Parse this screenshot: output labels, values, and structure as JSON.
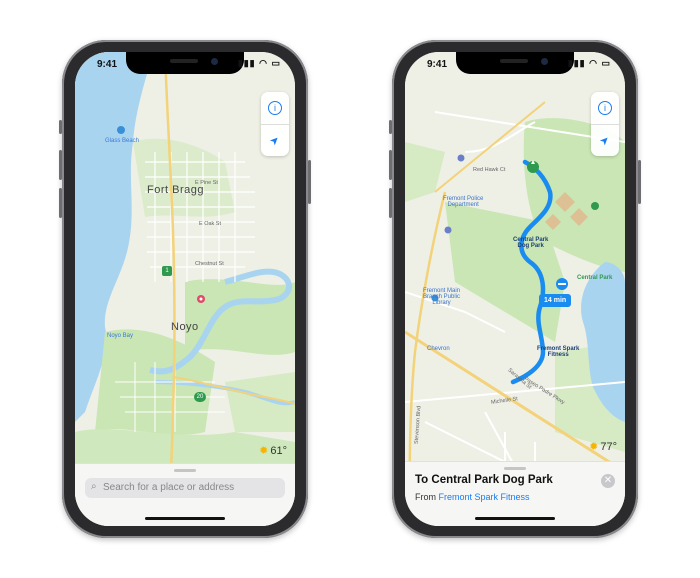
{
  "left_phone": {
    "status": {
      "time": "9:41",
      "icons": "▮▮▮ ◠ ▭"
    },
    "controls": {
      "info_icon": "i",
      "location_icon": "➤"
    },
    "map_labels": {
      "glass_beach": "Glass Beach",
      "fort_bragg": "Fort Bragg",
      "e_pine_st": "E Pine St",
      "e_oak_st": "E Oak St",
      "chestnut_st": "Chestnut St",
      "noyo": "Noyo",
      "noyo_bay": "Noyo Bay",
      "route_1": "1",
      "route_20": "20"
    },
    "weather": {
      "temp": "61°"
    },
    "search": {
      "placeholder": "Search for a place or address"
    }
  },
  "right_phone": {
    "status": {
      "time": "9:41",
      "icons": "▮▮▮ ◠ ▭"
    },
    "controls": {
      "info_icon": "i",
      "location_icon": "➤"
    },
    "map_labels": {
      "red_hawk_ct": "Red Hawk Ct",
      "police": "Fremont Police\nDepartment",
      "dog_park": "Central Park\nDog Park",
      "central_park": "Central Park",
      "library": "Fremont Main\nBranch Public\nLibrary",
      "eta": "14 min",
      "chevron": "Chevron",
      "fitness": "Fremont Spark\nFitness",
      "paseo_padre": "Paseo Padre Pkwy",
      "stevenson": "Stevenson Blvd",
      "sarasota": "Sarasota St",
      "michelle": "Michelle St"
    },
    "weather": {
      "temp": "77°"
    },
    "directions": {
      "title": "To Central Park Dog Park",
      "from_label": "From",
      "from_link": "Fremont Spark Fitness"
    }
  },
  "colors": {
    "water": "#a9d4f0",
    "land": "#eef0e6",
    "park": "#c9e6b4",
    "route": "#1a8cf0",
    "accent": "#1a7cf2"
  }
}
